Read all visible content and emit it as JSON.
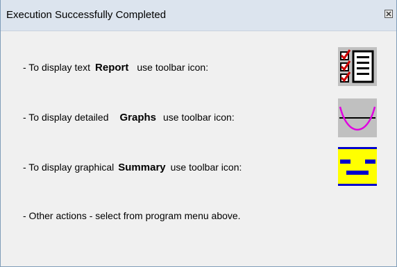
{
  "window": {
    "title": "Execution Successfully Completed"
  },
  "instructions": [
    {
      "prefix": "- To display text",
      "keyword": "Report",
      "suffix": "use toolbar icon:",
      "icon": "report-icon"
    },
    {
      "prefix": "- To display detailed",
      "keyword": "Graphs",
      "suffix": "use toolbar icon:",
      "icon": "graphs-icon"
    },
    {
      "prefix": "- To display graphical",
      "keyword": "Summary",
      "suffix": "use toolbar icon:",
      "icon": "summary-icon"
    }
  ],
  "footer_text": "- Other actions - select from program menu above.",
  "colors": {
    "window_bg": "#f0f0f0",
    "titlebar_bg": "#dce4ee",
    "graph_curve": "#e000e0",
    "summary_bg": "#ffff00",
    "summary_bars": "#0000cc",
    "report_checks": "#cc0000"
  }
}
